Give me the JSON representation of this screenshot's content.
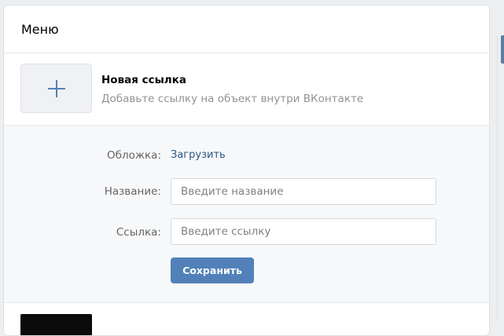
{
  "menu": {
    "title": "Меню"
  },
  "new_link": {
    "title": "Новая ссылка",
    "hint": "Добавьте ссылку на объект внутри ВКонтакте",
    "icon": "plus-icon"
  },
  "form": {
    "cover_label": "Обложка:",
    "upload_label": "Загрузить",
    "name_label": "Название:",
    "name_placeholder": "Введите название",
    "name_value": "",
    "link_label": "Ссылка:",
    "link_placeholder": "Введите ссылку",
    "link_value": "",
    "save_label": "Сохранить"
  },
  "colors": {
    "accent": "#5181b8",
    "link": "#2a5885",
    "plus": "#5181b8"
  }
}
